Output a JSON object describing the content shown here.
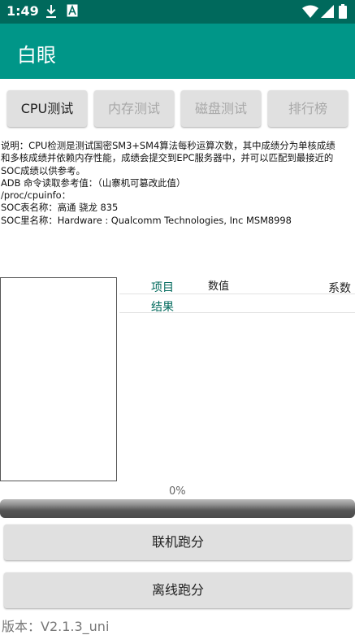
{
  "status_bar": {
    "time": "1:49",
    "icons": [
      "download-icon",
      "a-notification-icon",
      "wifi-icon",
      "signal-icon",
      "battery-icon"
    ]
  },
  "app_bar": {
    "title": "白眼"
  },
  "tabs": [
    {
      "label": "CPU测试",
      "active": true
    },
    {
      "label": "内存测试",
      "active": false
    },
    {
      "label": "磁盘测试",
      "active": false
    },
    {
      "label": "排行榜",
      "active": false
    }
  ],
  "description": {
    "line1": "说明：CPU检测是测试国密SM3+SM4算法每秒运算次数，其中成绩分为单核成绩",
    "line2": "和多核成绩并依赖内存性能，成绩会提交到EPC服务器中，并可以匹配到最接近的",
    "line3": "SOC成绩以供参考。",
    "line4": "ADB 命令读取参考值：（山寨机可篡改此值）",
    "line5": "/proc/cpuinfo：",
    "line6": "SOC表名称：高通 骁龙 835",
    "line7": "SOC里名称：Hardware : Qualcomm Technologies, Inc MSM8998"
  },
  "results_table": {
    "col_item": "项目",
    "col_value": "数值",
    "col_coef": "系数",
    "row_result": "结果"
  },
  "progress": {
    "text": "0%",
    "fraction": 0
  },
  "buttons": {
    "online": "联机跑分",
    "offline": "离线跑分"
  },
  "version": "版本：V2.1.3_uni",
  "colors": {
    "status_bar": "#00695c",
    "app_bar": "#009688",
    "table_header_accent": "#00695c",
    "button_bg": "#e0e0e0"
  }
}
